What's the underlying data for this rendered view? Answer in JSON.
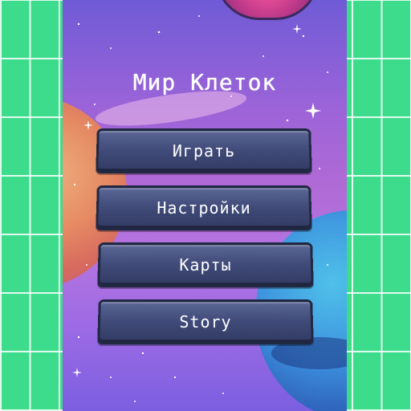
{
  "game": {
    "title": "Мир Клеток"
  },
  "menu": {
    "items": [
      {
        "label": "Играть"
      },
      {
        "label": "Настройки"
      },
      {
        "label": "Карты"
      },
      {
        "label": "Story"
      }
    ]
  },
  "colors": {
    "side_panel": "#3ddc8c",
    "grid_line": "#ffffff",
    "background_top": "#6f5bd6",
    "background_mid": "#b474e0",
    "button_fill": "#3f4a78",
    "button_border": "#202843",
    "text": "#ffffff"
  },
  "icons": [
    "planet-pink",
    "planet-orange",
    "planet-blue",
    "sparkle-star"
  ]
}
